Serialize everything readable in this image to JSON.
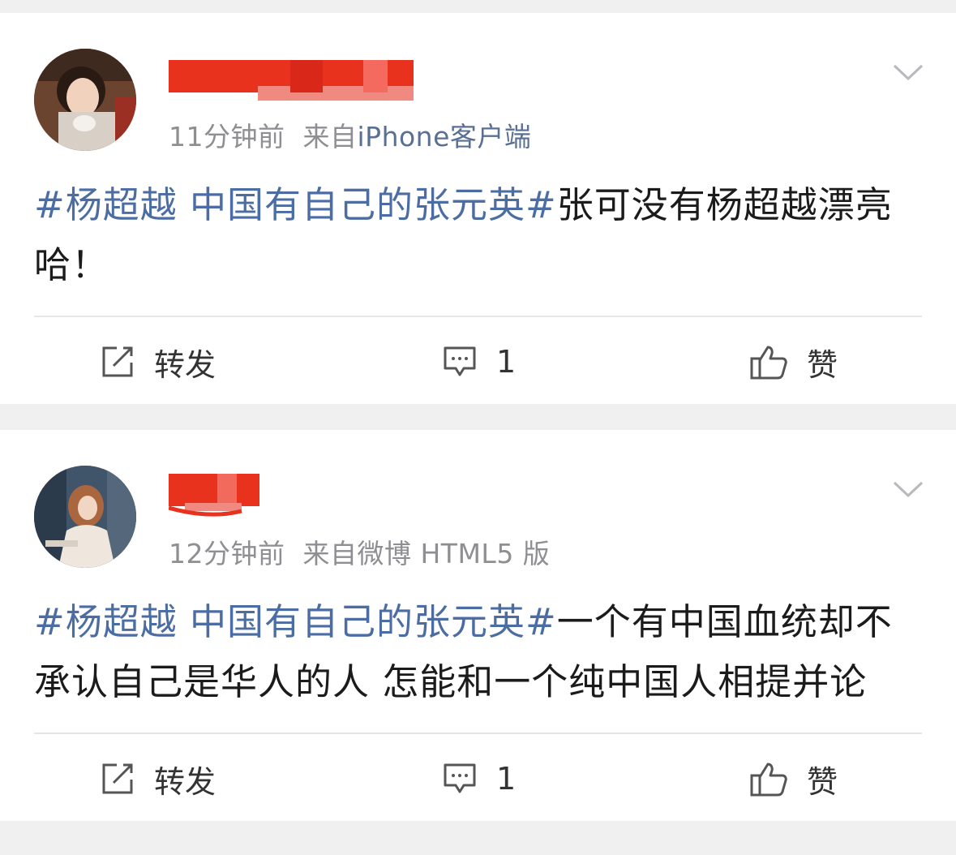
{
  "posts": [
    {
      "meta": {
        "time": "11分钟前",
        "source_prefix": "来自",
        "source": "iPhone客户端"
      },
      "hashtag": "#杨超越 中国有自己的张元英#",
      "body": "张可没有杨超越漂亮哈！",
      "actions": {
        "repost_label": "转发",
        "comment_count": "1",
        "like_label": "赞"
      }
    },
    {
      "meta": {
        "time": "12分钟前",
        "source_prefix": "来自",
        "source": "微博 HTML5 版"
      },
      "hashtag": "#杨超越 中国有自己的张元英#",
      "body": "一个有中国血统却不承认自己是华人的人 怎能和一个纯中国人相提并论",
      "actions": {
        "repost_label": "转发",
        "comment_count": "1",
        "like_label": "赞"
      }
    }
  ],
  "icons": {
    "repost": "repost-icon",
    "comment": "comment-icon",
    "like": "thumbs-up-icon",
    "more": "chevron-down-icon"
  },
  "colors": {
    "hashtag": "#4b6da3",
    "meta": "#8e8e93",
    "redaction": "#e8321e",
    "background": "#f0f0f0"
  }
}
